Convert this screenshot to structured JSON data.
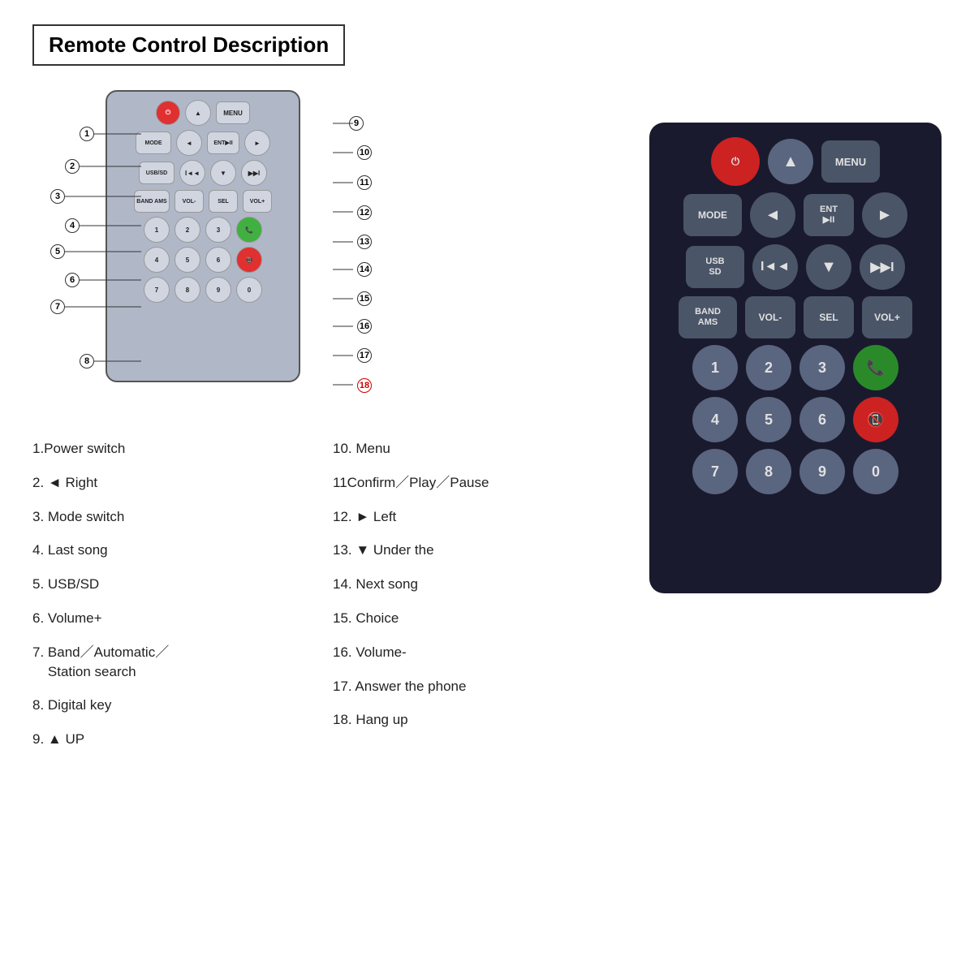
{
  "title": "Remote Control Description",
  "diagram": {
    "callouts": [
      {
        "num": "1",
        "label": "Power switch"
      },
      {
        "num": "2",
        "label": "◄ Right"
      },
      {
        "num": "3",
        "label": "Mode switch"
      },
      {
        "num": "4",
        "label": "Last song"
      },
      {
        "num": "5",
        "label": "USB/SD"
      },
      {
        "num": "6",
        "label": "Volume+"
      },
      {
        "num": "7",
        "label": "Band／Automatic／\nStation search"
      },
      {
        "num": "8",
        "label": "Digital key"
      },
      {
        "num": "9",
        "label": "▲ UP"
      }
    ],
    "callouts_right": [
      {
        "num": "10",
        "label": "Menu"
      },
      {
        "num": "11",
        "label": "Confirm／Play／Pause"
      },
      {
        "num": "12",
        "label": "► Left"
      },
      {
        "num": "13",
        "label": "▼ Under the"
      },
      {
        "num": "14",
        "label": "Next song"
      },
      {
        "num": "15",
        "label": "Choice"
      },
      {
        "num": "16",
        "label": "Volume-"
      },
      {
        "num": "17",
        "label": "Answer the phone"
      },
      {
        "num": "18",
        "label": "Hang up"
      }
    ]
  },
  "buttons": {
    "row1": [
      "⏻",
      "▲",
      "MENU"
    ],
    "row2_labels": [
      "MODE",
      "◄",
      "ENT\n▶II",
      "►"
    ],
    "row3_labels": [
      "USB\nSD",
      "I◄◄",
      "▼",
      "▶▶I"
    ],
    "row4_labels": [
      "BAND\nAMS",
      "VOL-",
      "SEL",
      "VOL+"
    ],
    "row5": [
      "1",
      "2",
      "3",
      "📞"
    ],
    "row6": [
      "4",
      "5",
      "6",
      "📵"
    ],
    "row7": [
      "7",
      "8",
      "9",
      "0"
    ]
  },
  "desc_left": [
    "1.Power switch",
    "2. ◄ Right",
    "3. Mode switch",
    "4. Last song",
    "5. USB/SD",
    "6. Volume+",
    "7. Band／Automatic／\n    Station search",
    "8. Digital key",
    "9. ▲ UP"
  ],
  "desc_right": [
    "10. Menu",
    "11Confirm／Play／Pause",
    "12. ► Left",
    "13. ▼ Under the",
    "14. Next song",
    "15. Choice",
    "16. Volume-",
    "17. Answer the phone",
    "18. Hang up"
  ]
}
